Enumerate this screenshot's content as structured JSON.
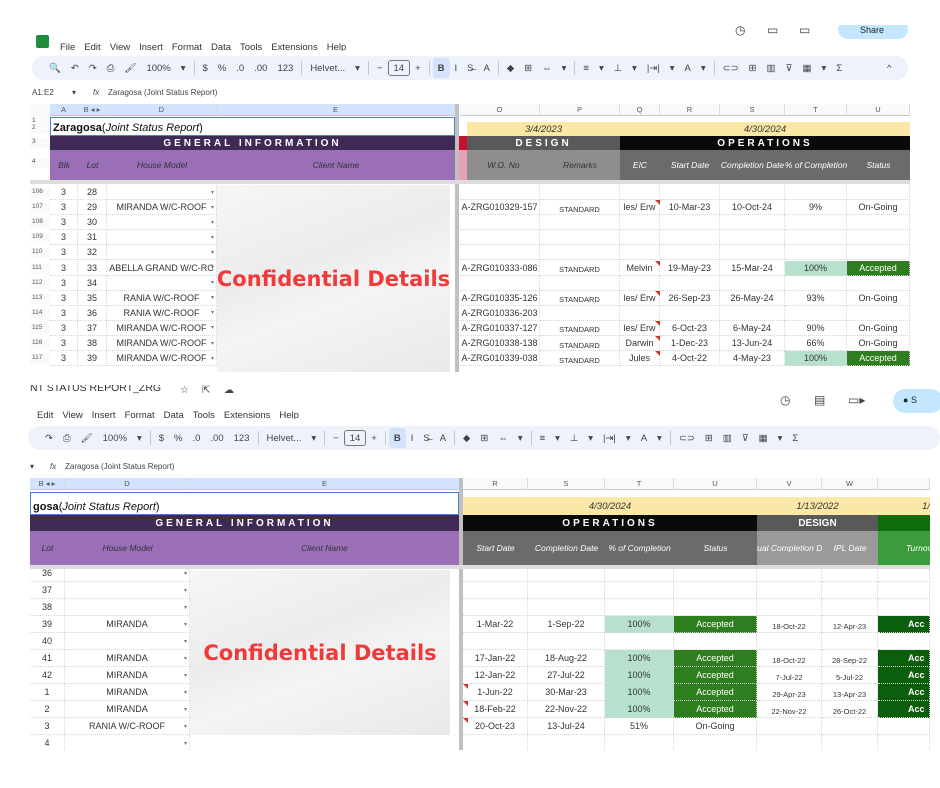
{
  "top": {
    "menu": [
      "File",
      "Edit",
      "View",
      "Insert",
      "Format",
      "Data",
      "Tools",
      "Extensions",
      "Help"
    ],
    "toolbar": [
      "🔍",
      "↶",
      "↷",
      "⎙",
      "🖌",
      "100%",
      "▾",
      "|",
      "$",
      "%",
      ".0",
      ".00",
      "123",
      "|",
      "Helvet...",
      "▾",
      "|",
      "−",
      "14",
      "+",
      "|",
      "B",
      "I",
      "S̶",
      "A",
      "|",
      "◆",
      "⊞",
      "⇔",
      "▾",
      "|",
      "≡",
      "▾",
      "⊥",
      "▾",
      "|⇥|",
      "▾",
      "A",
      "▾",
      "|",
      "⊂⊃",
      "⊞",
      "▥",
      "⊽",
      "▦",
      "▾",
      "Σ"
    ],
    "collapse": "^",
    "right_icons": [
      "history-icon",
      "comment-icon",
      "meet-icon"
    ],
    "share_label": "Share",
    "name_box": "A1:E2",
    "fx": "fx",
    "formula": "Zaragosa (Joint Status Report)",
    "cols": [
      "A",
      "B ◂ ▸",
      "D",
      "E",
      "O",
      "P",
      "Q",
      "R",
      "S",
      "T",
      "U"
    ],
    "rownums_head": [
      "1",
      "2",
      "3",
      "4"
    ],
    "title_bold": "Zaragosa",
    "title_italic": "Joint Status Report",
    "general_info": "GENERAL INFORMATION",
    "design_date": "3/4/2023",
    "ops_date": "4/30/2024",
    "design": "DESIGN",
    "operations": "OPERATIONS",
    "headers": [
      "Blk",
      "Lot",
      "House Model",
      "Client Name",
      "W.O. No",
      "Remarks",
      "EIC",
      "Start Date",
      "Completion Date",
      "% of Completion",
      "Status"
    ],
    "confidential": "Confidential Details",
    "rows": [
      {
        "n": "106",
        "blk": "3",
        "lot": "28",
        "model": "",
        "wo": "",
        "remarks": "",
        "eic": "",
        "start": "",
        "end": "",
        "pct": "",
        "status": ""
      },
      {
        "n": "107",
        "blk": "3",
        "lot": "29",
        "model": "MIRANDA W/C-ROOF",
        "wo": "A-ZRG010329-157",
        "remarks": "STANDARD",
        "eic": "les/ Erw",
        "start": "10-Mar-23",
        "end": "10-Oct-24",
        "pct": "9%",
        "status": "On-Going"
      },
      {
        "n": "108",
        "blk": "3",
        "lot": "30",
        "model": "",
        "wo": "",
        "remarks": "",
        "eic": "",
        "start": "",
        "end": "",
        "pct": "",
        "status": ""
      },
      {
        "n": "109",
        "blk": "3",
        "lot": "31",
        "model": "",
        "wo": "",
        "remarks": "",
        "eic": "",
        "start": "",
        "end": "",
        "pct": "",
        "status": ""
      },
      {
        "n": "110",
        "blk": "3",
        "lot": "32",
        "model": "",
        "wo": "",
        "remarks": "",
        "eic": "",
        "start": "",
        "end": "",
        "pct": "",
        "status": ""
      },
      {
        "n": "111",
        "blk": "3",
        "lot": "33",
        "model": "ABELLA GRAND W/C-RC",
        "wo": "A-ZRG010333-086",
        "remarks": "STANDARD",
        "eic": "Melvin",
        "start": "19-May-23",
        "end": "15-Mar-24",
        "pct": "100%",
        "status": "Accepted"
      },
      {
        "n": "112",
        "blk": "3",
        "lot": "34",
        "model": "",
        "wo": "",
        "remarks": "",
        "eic": "",
        "start": "",
        "end": "",
        "pct": "",
        "status": ""
      },
      {
        "n": "113",
        "blk": "3",
        "lot": "35",
        "model": "RANIA W/C-ROOF",
        "wo": "A-ZRG010335-126",
        "remarks": "STANDARD",
        "eic": "les/ Erw",
        "start": "26-Sep-23",
        "end": "26-May-24",
        "pct": "93%",
        "status": "On-Going"
      },
      {
        "n": "114",
        "blk": "3",
        "lot": "36",
        "model": "RANIA W/C-ROOF",
        "wo": "A-ZRG010336-203",
        "remarks": "",
        "eic": "",
        "start": "",
        "end": "",
        "pct": "",
        "status": ""
      },
      {
        "n": "115",
        "blk": "3",
        "lot": "37",
        "model": "MIRANDA W/C-ROOF",
        "wo": "A-ZRG010337-127",
        "remarks": "STANDARD",
        "eic": "les/ Erw",
        "start": "6-Oct-23",
        "end": "6-May-24",
        "pct": "90%",
        "status": "On-Going"
      },
      {
        "n": "116",
        "blk": "3",
        "lot": "38",
        "model": "MIRANDA W/C-ROOF",
        "wo": "A-ZRG010338-138",
        "remarks": "STANDARD",
        "eic": "Darwin",
        "start": "1-Dec-23",
        "end": "13-Jun-24",
        "pct": "66%",
        "status": "On-Going"
      },
      {
        "n": "117",
        "blk": "3",
        "lot": "39",
        "model": "MIRANDA W/C-ROOF",
        "wo": "A-ZRG010339-038",
        "remarks": "STANDARD",
        "eic": "Jules",
        "start": "4-Oct-22",
        "end": "4-May-23",
        "pct": "100%",
        "status": "Accepted"
      }
    ]
  },
  "bottom": {
    "doc_title": "NT STATUS REPORT_ZRG",
    "title_icons": [
      "☆",
      "⇱",
      "☁"
    ],
    "menu": [
      "Edit",
      "View",
      "Insert",
      "Format",
      "Data",
      "Tools",
      "Extensions",
      "Help"
    ],
    "toolbar": [
      "↷",
      "⎙",
      "🖌",
      "100%",
      "▾",
      "|",
      "$",
      "%",
      ".0",
      ".00",
      "123",
      "|",
      "Helvet...",
      "▾",
      "|",
      "−",
      "14",
      "+",
      "|",
      "B",
      "I",
      "S̶",
      "A",
      "|",
      "◆",
      "⊞",
      "⇔",
      "▾",
      "|",
      "≡",
      "▾",
      "⊥",
      "▾",
      "|⇥|",
      "▾",
      "A",
      "▾",
      "|",
      "⊂⊃",
      "⊞",
      "▥",
      "⊽",
      "▦",
      "▾",
      "Σ"
    ],
    "right_icons": [
      "history-icon",
      "comment-icon",
      "video-icon"
    ],
    "share_label": "S",
    "fx": "fx",
    "formula": "Zaragosa (Joint Status Report)",
    "cols": [
      "B ◂ ▸",
      "D",
      "E",
      "R",
      "S",
      "T",
      "U",
      "V",
      "W"
    ],
    "title_bold": "gosa",
    "title_italic": "Joint Status Report",
    "general_info": "GENERAL INFORMATION",
    "ops_date": "4/30/2024",
    "design_date": "1/13/2022",
    "turnover_date": "1/",
    "operations": "OPERATIONS",
    "design": "DESIGN",
    "headers": [
      "Lot",
      "House Model",
      "Client Name",
      "Start Date",
      "Completion Date",
      "% of Completion",
      "Status",
      "Actual Completion Date",
      "IPL Date",
      "Turnover"
    ],
    "confidential": "Confidential Details",
    "rows": [
      {
        "lot": "36",
        "model": "",
        "start": "",
        "end": "",
        "pct": "",
        "status": "",
        "actual": "",
        "ipl": "",
        "turn": ""
      },
      {
        "lot": "37",
        "model": "",
        "start": "",
        "end": "",
        "pct": "",
        "status": "",
        "actual": "",
        "ipl": "",
        "turn": ""
      },
      {
        "lot": "38",
        "model": "",
        "start": "",
        "end": "",
        "pct": "",
        "status": "",
        "actual": "",
        "ipl": "",
        "turn": ""
      },
      {
        "lot": "39",
        "model": "MIRANDA",
        "start": "1-Mar-22",
        "end": "1-Sep-22",
        "pct": "100%",
        "status": "Accepted",
        "actual": "18-Oct-22",
        "ipl": "12-Apr-23",
        "turn": "Acc"
      },
      {
        "lot": "40",
        "model": "",
        "start": "",
        "end": "",
        "pct": "",
        "status": "",
        "actual": "",
        "ipl": "",
        "turn": ""
      },
      {
        "lot": "41",
        "model": "MIRANDA",
        "start": "17-Jan-22",
        "end": "18-Aug-22",
        "pct": "100%",
        "status": "Accepted",
        "actual": "18-Oct-22",
        "ipl": "28-Sep-22",
        "turn": "Acc"
      },
      {
        "lot": "42",
        "model": "MIRANDA",
        "start": "12-Jan-22",
        "end": "27-Jul-22",
        "pct": "100%",
        "status": "Accepted",
        "actual": "7-Jul-22",
        "ipl": "5-Jul-22",
        "turn": "Acc"
      },
      {
        "lot": "1",
        "model": "MIRANDA",
        "start": "1-Jun-22",
        "end": "30-Mar-23",
        "pct": "100%",
        "status": "Accepted",
        "actual": "29-Apr-23",
        "ipl": "13-Apr-23",
        "turn": "Acc"
      },
      {
        "lot": "2",
        "model": "MIRANDA",
        "start": "18-Feb-22",
        "end": "22-Nov-22",
        "pct": "100%",
        "status": "Accepted",
        "actual": "22-Nov-22",
        "ipl": "26-Oct-22",
        "turn": "Acc"
      },
      {
        "lot": "3",
        "model": "RANIA W/C-ROOF",
        "start": "20-Oct-23",
        "end": "13-Jul-24",
        "pct": "51%",
        "status": "On-Going",
        "actual": "",
        "ipl": "",
        "turn": ""
      },
      {
        "lot": "4",
        "model": "",
        "start": "",
        "end": "",
        "pct": "",
        "status": "",
        "actual": "",
        "ipl": "",
        "turn": ""
      }
    ]
  },
  "colors": {
    "purple_dark": "#3f2a55",
    "purple": "#9a6fb8",
    "yellow": "#fce8a6",
    "black": "#0a0a0a",
    "gray_dark": "#595959",
    "gray": "#6b6b6b",
    "gray_light": "#9a9a9a",
    "green_light": "#b7e1cd",
    "green": "#2e7d1e",
    "green_dark": "#0b5e0b",
    "red_text": "#f03a3a"
  }
}
